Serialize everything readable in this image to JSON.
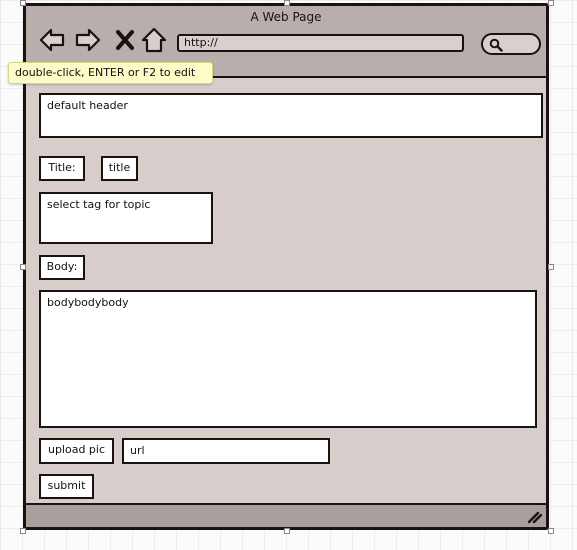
{
  "window": {
    "title": "A Web Page",
    "url": "http://"
  },
  "tooltip": {
    "text": "double-click, ENTER or F2 to edit"
  },
  "form": {
    "header_value": "default header",
    "title_label": "Title:",
    "title_value": "title",
    "tag_value": "select tag for topic",
    "body_label": "Body:",
    "body_value": "bodybodybody",
    "upload_button": "upload pic",
    "url_value": "url",
    "submit_button": "submit"
  },
  "colors": {
    "window_bg": "#d7cdcb",
    "titlebar_bg": "#b8aeab",
    "border": "#1a1212",
    "tooltip_bg": "#fdfbc8"
  },
  "icons": [
    "back-arrow-icon",
    "forward-arrow-icon",
    "close-x-icon",
    "home-icon",
    "search-icon",
    "resize-grip-icon"
  ]
}
